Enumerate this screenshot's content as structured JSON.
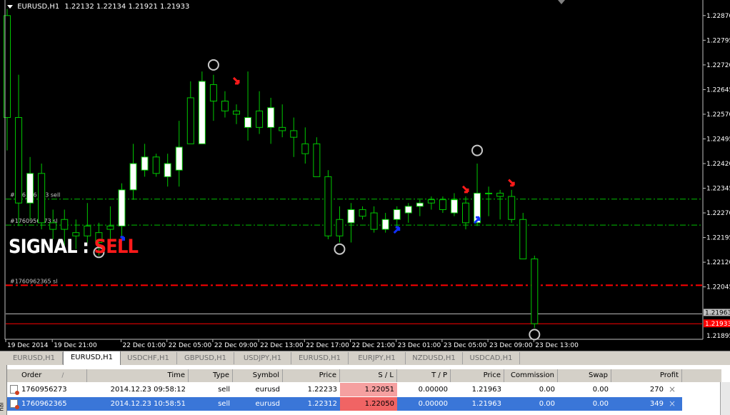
{
  "chart_header": {
    "symbol_tf": "EURUSD,H1",
    "ohlc": "1.22132 1.22134 1.21921 1.21933"
  },
  "signal": {
    "prefix": "SIGNAL :",
    "value": "SELL"
  },
  "colors": {
    "background": "#000000",
    "bull_candle_body": "#ffffff",
    "bear_candle_body": "#000000",
    "wick": "#00c800",
    "order_line": "#00c000",
    "sl_line": "#ff0000",
    "bid_line": "#ff0000",
    "ask_line": "#c0c0c0",
    "signal_sell": "#ff1a1a",
    "buy_arrow": "#1030ff",
    "sell_arrow": "#ff1a1a",
    "marker_circle": "#c8c8c8",
    "sl_cell": "#f5a0a0",
    "selected_row": "#3a76d8"
  },
  "price_axis": {
    "labels": [
      "1.22870",
      "1.22795",
      "1.22720",
      "1.22645",
      "1.22570",
      "1.22495",
      "1.22420",
      "1.22345",
      "1.22270",
      "1.22195",
      "1.22120",
      "1.22045"
    ],
    "bottom_label": "1.21895",
    "bid_label": "1.21933",
    "ask_label": "1.21963"
  },
  "time_axis": {
    "labels": [
      "19 Dec 2014",
      "19 Dec 21:00",
      "22 Dec 01:00",
      "22 Dec 05:00",
      "22 Dec 09:00",
      "22 Dec 13:00",
      "22 Dec 17:00",
      "22 Dec 21:00",
      "23 Dec 01:00",
      "23 Dec 05:00",
      "23 Dec 09:00",
      "23 Dec 13:00"
    ]
  },
  "chart_lines": [
    {
      "label": "#1760956273 sell",
      "label_shown": "#176_ _6 _73 sell",
      "price": 1.22312,
      "style": "dash-dot",
      "kind": "order"
    },
    {
      "label": "#1760956273 sl",
      "label_shown": "#1760956273 sl",
      "price": 1.22233,
      "style": "dash-dot",
      "kind": "order"
    },
    {
      "label": "#1760962365 sl",
      "label_shown": "#1760962365 sl",
      "price": 1.2205,
      "style": "dash-dot",
      "kind": "sl"
    },
    {
      "label": "ask",
      "price": 1.21963,
      "style": "solid",
      "kind": "ask"
    },
    {
      "label": "bid",
      "price": 1.21933,
      "style": "solid",
      "kind": "bid"
    }
  ],
  "chart_data": {
    "type": "candlestick",
    "symbol": "EURUSD",
    "timeframe": "H1",
    "y_range": [
      1.2189,
      1.229
    ],
    "ohlc": [
      [
        1.2287,
        1.2289,
        1.2246,
        1.2256
      ],
      [
        1.2256,
        1.2269,
        1.2223,
        1.223
      ],
      [
        1.223,
        1.2244,
        1.2225,
        1.2239
      ],
      [
        1.2239,
        1.2242,
        1.2222,
        1.2224
      ],
      [
        1.2224,
        1.2228,
        1.2219,
        1.2222
      ],
      [
        1.2222,
        1.2228,
        1.2217,
        1.2225
      ],
      [
        1.2221,
        1.2225,
        1.2216,
        1.222
      ],
      [
        1.222,
        1.223,
        1.2218,
        1.2223
      ],
      [
        1.2218,
        1.2224,
        1.2214,
        1.2221
      ],
      [
        1.2222,
        1.2229,
        1.2218,
        1.2223
      ],
      [
        1.2223,
        1.2236,
        1.2219,
        1.2234
      ],
      [
        1.2234,
        1.2248,
        1.2231,
        1.2242
      ],
      [
        1.224,
        1.2248,
        1.2238,
        1.2244
      ],
      [
        1.2244,
        1.2245,
        1.2238,
        1.2239
      ],
      [
        1.2238,
        1.2245,
        1.2235,
        1.2242
      ],
      [
        1.2247,
        1.2255,
        1.2235,
        1.224
      ],
      [
        1.2262,
        1.2267,
        1.2248,
        1.2248
      ],
      [
        1.2248,
        1.227,
        1.2248,
        1.2267
      ],
      [
        1.2266,
        1.2269,
        1.2255,
        1.2261
      ],
      [
        1.2261,
        1.2264,
        1.2256,
        1.2258
      ],
      [
        1.2258,
        1.226,
        1.2254,
        1.2257
      ],
      [
        1.2253,
        1.227,
        1.2249,
        1.2256
      ],
      [
        1.2258,
        1.2264,
        1.2251,
        1.2253
      ],
      [
        1.2253,
        1.2262,
        1.2248,
        1.2259
      ],
      [
        1.2252,
        1.226,
        1.225,
        1.2253
      ],
      [
        1.225,
        1.2256,
        1.2244,
        1.2252
      ],
      [
        1.2245,
        1.2253,
        1.2242,
        1.2248
      ],
      [
        1.2248,
        1.225,
        1.2238,
        1.2238
      ],
      [
        1.2238,
        1.224,
        1.2219,
        1.222
      ],
      [
        1.2225,
        1.2229,
        1.2218,
        1.222
      ],
      [
        1.2224,
        1.223,
        1.2218,
        1.2228
      ],
      [
        1.2228,
        1.2229,
        1.2225,
        1.2226
      ],
      [
        1.2227,
        1.2229,
        1.2221,
        1.2222
      ],
      [
        1.2222,
        1.2227,
        1.2221,
        1.2225
      ],
      [
        1.2225,
        1.2229,
        1.2223,
        1.2228
      ],
      [
        1.2227,
        1.223,
        1.2224,
        1.2229
      ],
      [
        1.2229,
        1.2231,
        1.2226,
        1.223
      ],
      [
        1.223,
        1.2232,
        1.2228,
        1.2231
      ],
      [
        1.2231,
        1.2232,
        1.2227,
        1.2228
      ],
      [
        1.2227,
        1.2233,
        1.2226,
        1.2231
      ],
      [
        1.223,
        1.2232,
        1.2222,
        1.2224
      ],
      [
        1.2224,
        1.2242,
        1.2223,
        1.2233
      ],
      [
        1.2233,
        1.2235,
        1.2226,
        1.2233
      ],
      [
        1.2233,
        1.2234,
        1.2225,
        1.2232
      ],
      [
        1.2232,
        1.2234,
        1.2224,
        1.2225
      ],
      [
        1.2225,
        1.2227,
        1.2213,
        1.2213
      ],
      [
        1.2213,
        1.2214,
        1.2192,
        1.21933
      ]
    ],
    "bull_indices": [
      2,
      10,
      11,
      12,
      14,
      15,
      17,
      21,
      23,
      30,
      33,
      34,
      35,
      36,
      39,
      41
    ],
    "markers": [
      {
        "type": "circle",
        "bar": 8,
        "price": 1.2215
      },
      {
        "type": "buy_arrow",
        "bar": 10,
        "price": 1.2219
      },
      {
        "type": "circle",
        "bar": 18,
        "price": 1.2272
      },
      {
        "type": "sell_arrow",
        "bar": 20,
        "price": 1.2267
      },
      {
        "type": "circle",
        "bar": 29,
        "price": 1.2216
      },
      {
        "type": "buy_arrow",
        "bar": 34,
        "price": 1.2222
      },
      {
        "type": "sell_arrow",
        "bar": 40,
        "price": 1.2234
      },
      {
        "type": "buy_arrow",
        "bar": 41,
        "price": 1.2225
      },
      {
        "type": "circle",
        "bar": 41,
        "price": 1.2246
      },
      {
        "type": "sell_arrow",
        "bar": 44,
        "price": 1.2236
      },
      {
        "type": "circle",
        "bar": 46,
        "price": 1.219
      }
    ]
  },
  "symbol_tabs": [
    "EURUSD,H1",
    "EURUSD,H1",
    "USDCHF,H1",
    "GBPUSD,H1",
    "USDJPY,H1",
    "EURUSD,H1",
    "EURJPY,H1",
    "NZDUSD,H1",
    "USDCAD,H1"
  ],
  "active_tab_index": 1,
  "terminal": {
    "side_label": "nal",
    "columns": [
      "Order",
      "Time",
      "Type",
      "Symbol",
      "Price",
      "S / L",
      "T / P",
      "Price",
      "Commission",
      "Swap",
      "Profit"
    ],
    "sort_indicator": "/",
    "rows": [
      {
        "order": "1760956273",
        "time": "2014.12.23 09:58:12",
        "type": "sell",
        "symbol": "eurusd",
        "price": "1.22233",
        "sl": "1.22051",
        "tp": "0.00000",
        "cur_price": "1.21963",
        "commission": "0.00",
        "swap": "0.00",
        "profit": "270",
        "close": "×",
        "selected": false
      },
      {
        "order": "1760962365",
        "time": "2014.12.23 10:58:51",
        "type": "sell",
        "symbol": "eurusd",
        "price": "1.22312",
        "sl": "1.22050",
        "tp": "0.00000",
        "cur_price": "1.21963",
        "commission": "0.00",
        "swap": "0.00",
        "profit": "349",
        "close": "×",
        "selected": true
      }
    ]
  }
}
